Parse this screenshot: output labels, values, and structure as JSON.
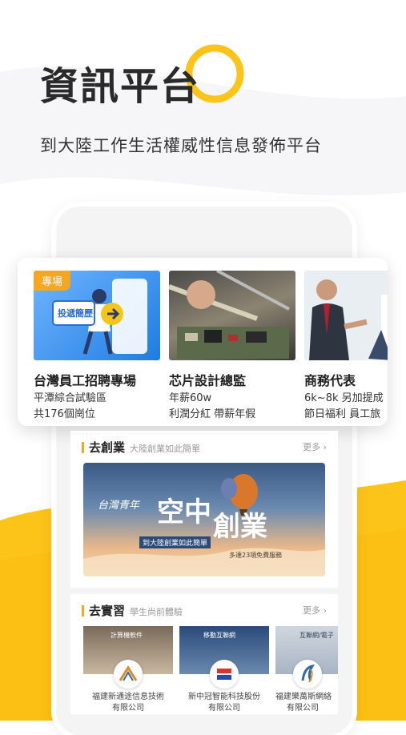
{
  "hero": {
    "title": "資訊平台",
    "subtitle": "到大陸工作生活權威性信息發佈平台"
  },
  "jobs": [
    {
      "tag": "專場",
      "title": "台灣員工招聘專場",
      "line1": "平潭綜合試驗區",
      "line2": "共176個崗位",
      "thumb_text": "投遞簡歷"
    },
    {
      "title": "芯片設計總監",
      "line1": "年薪60w",
      "line2": "利潤分紅 帶薪年假"
    },
    {
      "title": "商務代表",
      "line1": "6k~8k 另加提成",
      "line2": "節日福利 員工旅"
    }
  ],
  "startup": {
    "label": "去創業",
    "desc": "大陸創業如此簡單",
    "more": "更多 ›",
    "banner_small": "台灣青年",
    "banner_big1": "空中",
    "banner_big2": "創業",
    "banner_badge": "到大陸創業如此簡單",
    "banner_foot": "多達23項免費服務"
  },
  "intern": {
    "label": "去實習",
    "desc": "學生尚前體驗",
    "more": "更多 ›",
    "companies": [
      {
        "sign": "計算機軟件",
        "name1": "福建新通途信息技術",
        "name2": "有限公司"
      },
      {
        "sign": "移動互聯網",
        "name1": "新中冠智能科技股份",
        "name2": "有限公司"
      },
      {
        "sign": "互聯網/電子",
        "name1": "福建樂萬斯網絡",
        "name2": "有限公司"
      }
    ]
  },
  "colors": {
    "accent": "#f5a623",
    "yellow_bg": "#fcc419"
  }
}
